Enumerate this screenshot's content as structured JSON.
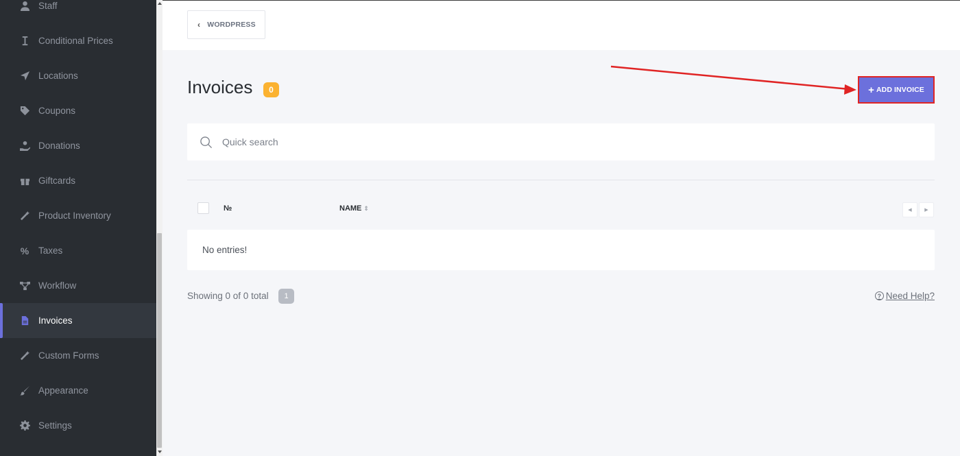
{
  "sidebar": {
    "items": [
      {
        "label": "Staff",
        "icon": "user-icon"
      },
      {
        "label": "Conditional Prices",
        "icon": "cursor-icon"
      },
      {
        "label": "Locations",
        "icon": "location-arrow-icon"
      },
      {
        "label": "Coupons",
        "icon": "tag-icon"
      },
      {
        "label": "Donations",
        "icon": "hand-holding-icon"
      },
      {
        "label": "Giftcards",
        "icon": "gift-icon"
      },
      {
        "label": "Product Inventory",
        "icon": "magic-wand-icon"
      },
      {
        "label": "Taxes",
        "icon": "percent-icon"
      },
      {
        "label": "Workflow",
        "icon": "workflow-icon"
      },
      {
        "label": "Invoices",
        "icon": "file-icon",
        "active": true
      },
      {
        "label": "Custom Forms",
        "icon": "magic-wand-icon"
      },
      {
        "label": "Appearance",
        "icon": "brush-icon"
      },
      {
        "label": "Settings",
        "icon": "gear-icon"
      }
    ]
  },
  "topbar": {
    "back_label": "WORDPRESS",
    "back_icon": "chevron-left-icon"
  },
  "header": {
    "title": "Invoices",
    "count": "0",
    "add_label": "ADD INVOICE",
    "add_icon": "plus-icon"
  },
  "search": {
    "placeholder": "Quick search",
    "icon": "search-icon"
  },
  "table": {
    "columns": [
      "№",
      "NAME"
    ],
    "sort_icon": "sort-icon",
    "empty_text": "No entries!"
  },
  "footer": {
    "showing_text": "Showing 0 of 0 total",
    "page": "1",
    "help_label": "Need Help?",
    "help_icon": "question-circle-icon"
  },
  "colors": {
    "sidebar_bg": "#292d32",
    "accent": "#6c70dc",
    "badge": "#fbb231",
    "annotation": "#e02424"
  }
}
